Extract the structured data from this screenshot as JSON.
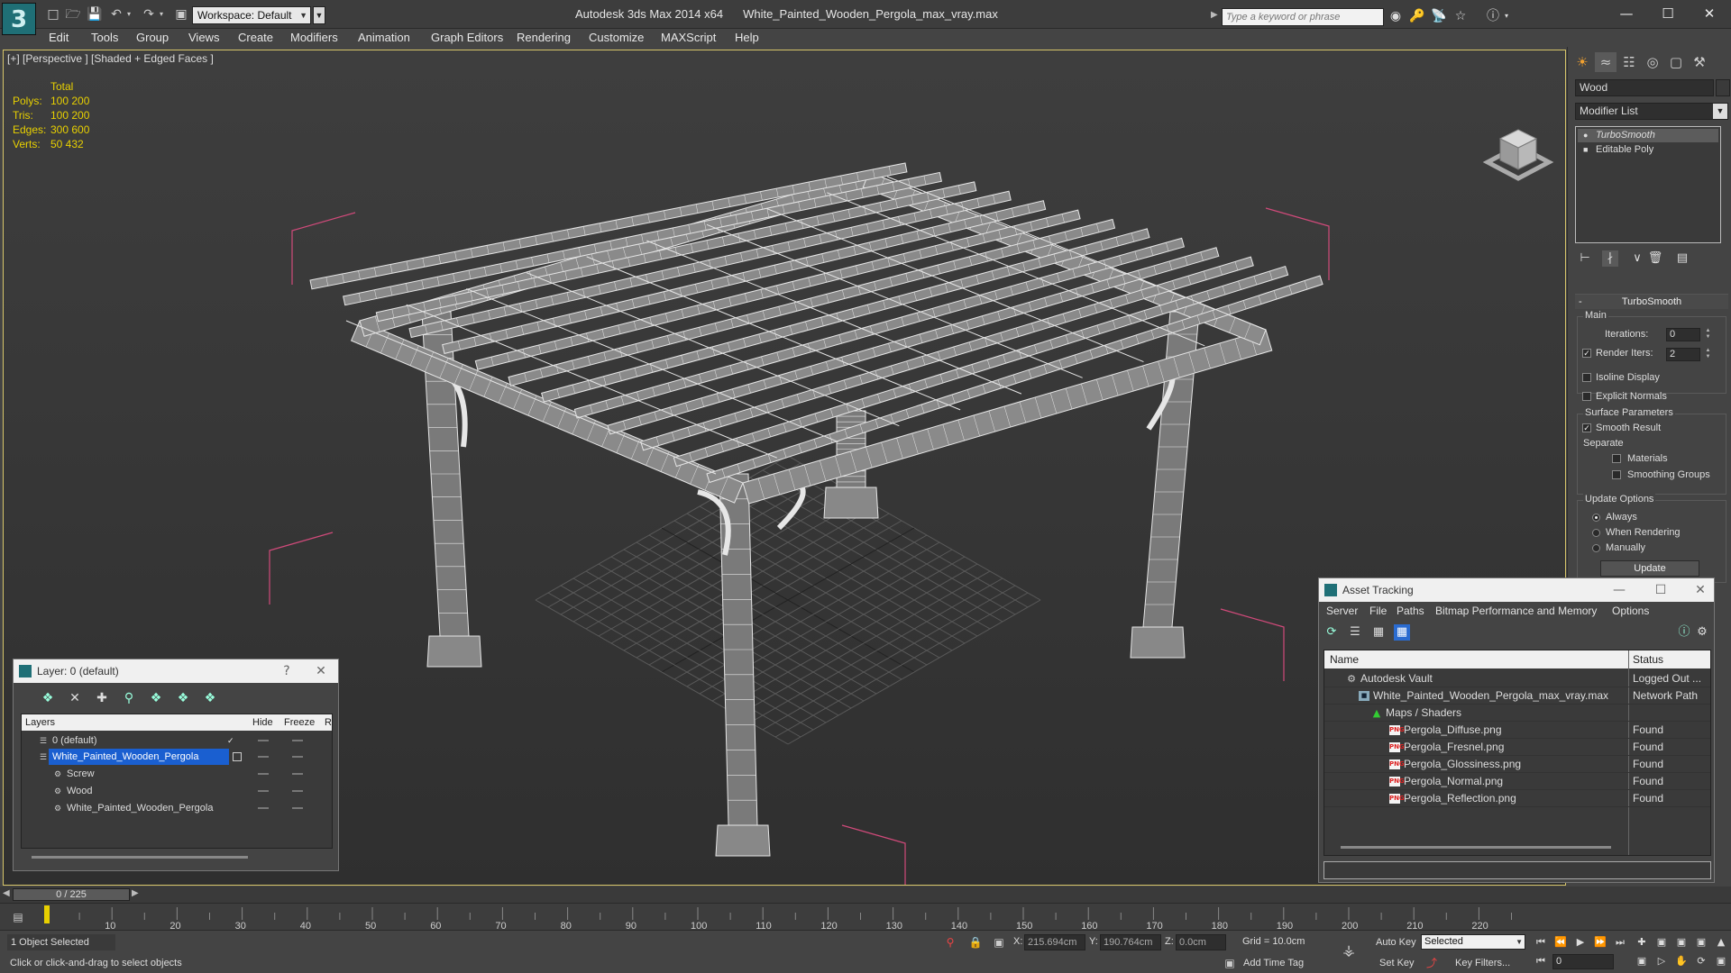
{
  "title_bar": {
    "app_name": "Autodesk 3ds Max  2014 x64",
    "file_name": "White_Painted_Wooden_Pergola_max_vray.max",
    "workspace": "Workspace: Default",
    "search_placeholder": "Type a keyword or phrase"
  },
  "menu": [
    "Edit",
    "Tools",
    "Group",
    "Views",
    "Create",
    "Modifiers",
    "Animation",
    "Graph Editors",
    "Rendering",
    "Customize",
    "MAXScript",
    "Help"
  ],
  "viewport": {
    "label": "[+] [Perspective ] [Shaded + Edged Faces ]",
    "stats": {
      "header": "Total",
      "rows": [
        {
          "label": "Polys:",
          "value": "100 200"
        },
        {
          "label": "Tris:",
          "value": "100 200"
        },
        {
          "label": "Edges:",
          "value": "300 600"
        },
        {
          "label": "Verts:",
          "value": "50 432"
        }
      ]
    },
    "colors": {
      "stats": "#e8d000",
      "wire": "#e6e6e6",
      "bbox": "#d04a7a",
      "border": "#d8c66a"
    }
  },
  "command_panel": {
    "object_name": "Wood",
    "modifier_list": "Modifier List",
    "stack": [
      "TurboSmooth",
      "Editable Poly"
    ],
    "rollout_title": "TurboSmooth",
    "main_group": "Main",
    "iterations_label": "Iterations:",
    "iterations_value": "0",
    "render_iters_label": "Render Iters:",
    "render_iters_value": "2",
    "isoline_display": "Isoline Display",
    "explicit_normals": "Explicit Normals",
    "surface_params_group": "Surface Parameters",
    "smooth_result": "Smooth Result",
    "separate_label": "Separate",
    "materials": "Materials",
    "smoothing_groups": "Smoothing Groups",
    "update_options_group": "Update Options",
    "opt_always": "Always",
    "opt_when_rendering": "When Rendering",
    "opt_manually": "Manually",
    "update_button": "Update"
  },
  "layer_window": {
    "title": "Layer: 0 (default)",
    "help": "?",
    "columns": {
      "layers": "Layers",
      "hide": "Hide",
      "freeze": "Freeze",
      "render": "R"
    },
    "rows": [
      {
        "name": "0 (default)"
      },
      {
        "name": "White_Painted_Wooden_Pergola"
      },
      {
        "name": "Screw"
      },
      {
        "name": "Wood"
      },
      {
        "name": "White_Painted_Wooden_Pergola"
      }
    ]
  },
  "asset_tracking": {
    "title": "Asset Tracking",
    "menu": [
      "Server",
      "File",
      "Paths",
      "Bitmap Performance and Memory",
      "Options"
    ],
    "columns": {
      "name": "Name",
      "status": "Status"
    },
    "rows": [
      {
        "name": "Autodesk Vault",
        "status": "Logged Out ..."
      },
      {
        "name": "White_Painted_Wooden_Pergola_max_vray.max",
        "status": "Network Path"
      },
      {
        "name": "Maps / Shaders",
        "status": ""
      },
      {
        "name": "Pergola_Diffuse.png",
        "status": "Found"
      },
      {
        "name": "Pergola_Fresnel.png",
        "status": "Found"
      },
      {
        "name": "Pergola_Glossiness.png",
        "status": "Found"
      },
      {
        "name": "Pergola_Normal.png",
        "status": "Found"
      },
      {
        "name": "Pergola_Reflection.png",
        "status": "Found"
      }
    ]
  },
  "timeline": {
    "frame_readout": "0 / 225",
    "ticks": [
      0,
      10,
      20,
      30,
      40,
      50,
      60,
      70,
      80,
      90,
      100,
      110,
      120,
      130,
      140,
      150,
      160,
      170,
      180,
      190,
      200,
      210,
      220
    ],
    "tick_labels": [
      "10",
      "20",
      "30",
      "40",
      "50",
      "60",
      "70",
      "80",
      "90",
      "100",
      "110",
      "120",
      "130",
      "140",
      "150",
      "160",
      "170",
      "180",
      "190",
      "200",
      "210",
      "220"
    ]
  },
  "status_bar": {
    "selection": "1 Object Selected",
    "prompt": "Click or click-and-drag to select objects",
    "x_label": "X:",
    "x_value": "215.694cm",
    "y_label": "Y:",
    "y_value": "190.764cm",
    "z_label": "Z:",
    "z_value": "0.0cm",
    "grid": "Grid = 10.0cm",
    "add_time_tag": "Add Time Tag",
    "auto_key": "Auto Key",
    "set_key": "Set Key",
    "selected_dropdown": "Selected",
    "key_filters": "Key Filters...",
    "frame_value": "0"
  }
}
